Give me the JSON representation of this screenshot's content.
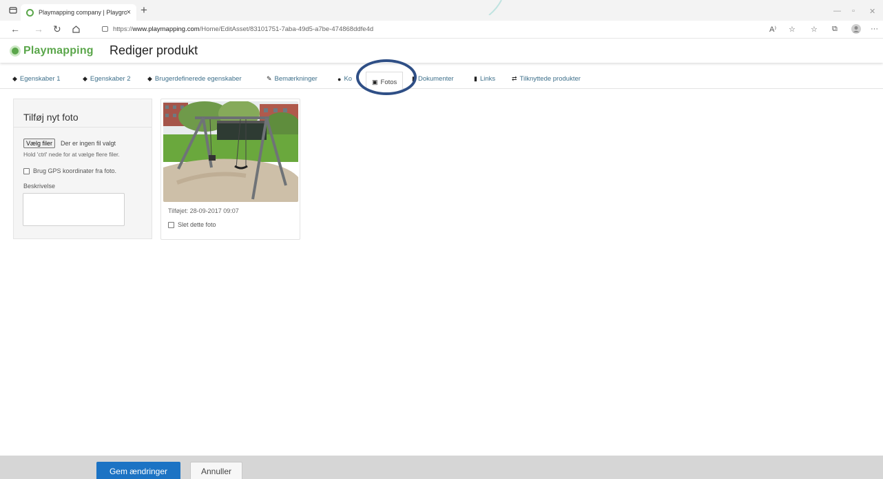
{
  "browser": {
    "tab_title": "Playmapping company | Playgro",
    "tab_close": "×",
    "new_tab": "+",
    "url_prefix": "https://",
    "url_domain": "www.playmapping.com",
    "url_path": "/Home/EditAsset/83101751-7aba-49d5-a7be-474868ddfe4d",
    "read_aloud": "A⁾",
    "more": "···"
  },
  "app": {
    "logo_text": "Playmapping",
    "page_title": "Rediger produkt",
    "brand_color": "#5aa64a",
    "accent_color": "#1c73c4"
  },
  "tabs": [
    {
      "label": "Egenskaber 1",
      "icon": "tag-icon"
    },
    {
      "label": "Egenskaber 2",
      "icon": "tag-icon"
    },
    {
      "label": "Brugerdefinerede egenskaber",
      "icon": "tags-icon"
    },
    {
      "label": "Bemærkninger",
      "icon": "pencil-icon"
    },
    {
      "label": "Ko",
      "icon": "map-marker-icon"
    },
    {
      "label": "Fotos",
      "icon": "picture-icon",
      "active": true
    },
    {
      "label": "Dokumenter",
      "icon": "file-icon"
    },
    {
      "label": "Links",
      "icon": "bookmark-icon"
    },
    {
      "label": "Tilknyttede produkter",
      "icon": "retweet-icon"
    }
  ],
  "add_photo": {
    "title": "Tilføj nyt foto",
    "file_button": "Vælg filer",
    "no_file": "Der er ingen fil valgt",
    "hint": "Hold 'ctrl' nede for at vælge flere filer.",
    "gps_label": "Brug GPS koordinater fra foto.",
    "description_label": "Beskrivelse",
    "description_value": ""
  },
  "photo_card": {
    "added": "Tilføjet: 28-09-2017 09:07",
    "delete_label": "Slet dette foto",
    "image_icon": "swing-photo"
  },
  "footer": {
    "save_label": "Gem ændringer",
    "cancel_label": "Annuller"
  }
}
